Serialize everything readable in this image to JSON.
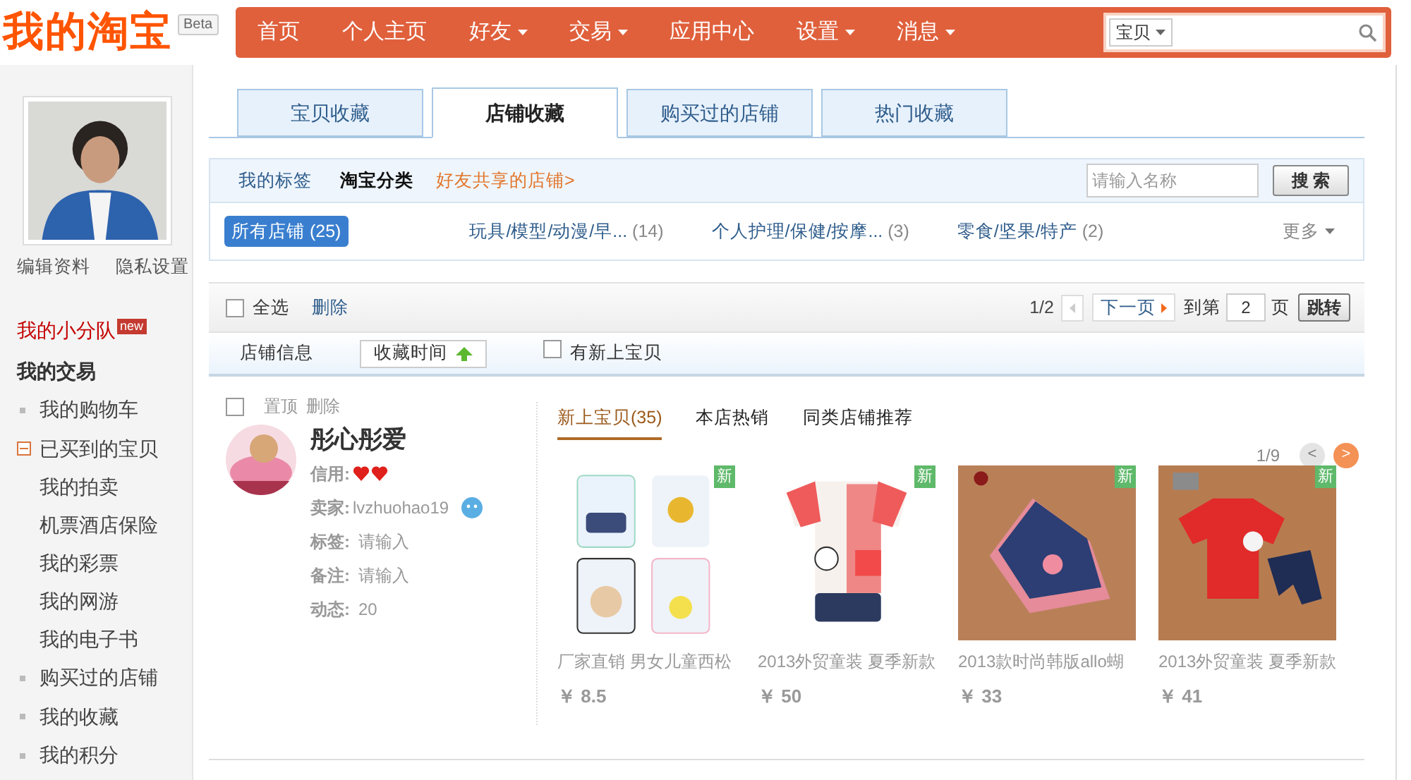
{
  "header": {
    "logo": "我的淘宝",
    "beta": "Beta",
    "nav": [
      {
        "label": "首页",
        "dropdown": false
      },
      {
        "label": "个人主页",
        "dropdown": false
      },
      {
        "label": "好友",
        "dropdown": true
      },
      {
        "label": "交易",
        "dropdown": true
      },
      {
        "label": "应用中心",
        "dropdown": false
      },
      {
        "label": "设置",
        "dropdown": true
      },
      {
        "label": "消息",
        "dropdown": true
      }
    ],
    "search": {
      "scope": "宝贝"
    }
  },
  "sidebar": {
    "profile_links": [
      "编辑资料",
      "隐私设置"
    ],
    "items": [
      {
        "kind": "feature",
        "label": "我的小分队",
        "badge": "new"
      },
      {
        "kind": "heading",
        "label": "我的交易"
      },
      {
        "kind": "bullet",
        "label": "我的购物车"
      },
      {
        "kind": "expanded",
        "label": "已买到的宝贝"
      },
      {
        "kind": "sub",
        "label": "我的拍卖"
      },
      {
        "kind": "sub",
        "label": "机票酒店保险"
      },
      {
        "kind": "sub",
        "label": "我的彩票"
      },
      {
        "kind": "sub",
        "label": "我的网游"
      },
      {
        "kind": "sub",
        "label": "我的电子书"
      },
      {
        "kind": "bullet",
        "label": "购买过的店铺"
      },
      {
        "kind": "bullet",
        "label": "我的收藏"
      },
      {
        "kind": "bullet",
        "label": "我的积分"
      }
    ]
  },
  "tabs": [
    {
      "label": "宝贝收藏",
      "selected": false
    },
    {
      "label": "店铺收藏",
      "selected": true
    },
    {
      "label": "购买过的店铺",
      "selected": false
    },
    {
      "label": "热门收藏",
      "selected": false
    }
  ],
  "filter": {
    "subtabs": [
      {
        "label": "我的标签",
        "selected": false
      },
      {
        "label": "淘宝分类",
        "selected": true
      }
    ],
    "shared_link": "好友共享的店铺>",
    "search_placeholder": "请输入名称",
    "search_button": "搜 索",
    "categories": [
      {
        "label": "所有店铺",
        "count": "(25)",
        "selected": true
      },
      {
        "label": "玩具/模型/动漫/早...",
        "count": "(14)",
        "selected": false
      },
      {
        "label": "个人护理/保健/按摩...",
        "count": "(3)",
        "selected": false
      },
      {
        "label": "零食/坚果/特产",
        "count": "(2)",
        "selected": false
      }
    ],
    "more": "更多"
  },
  "toolbar": {
    "select_all": {
      "label": "全选",
      "checked": false
    },
    "delete": "删除",
    "page": "1/2",
    "next": "下一页",
    "goto_label": "到第",
    "goto_value": "2",
    "page_unit": "页",
    "jump": "跳转"
  },
  "sortbar": {
    "info": "店铺信息",
    "sort": "收藏时间",
    "new_only": {
      "label": "有新上宝贝",
      "checked": false
    }
  },
  "shop": {
    "checked": false,
    "pin": "置顶",
    "delete": "删除",
    "name": "彤心彤爱",
    "fields": [
      {
        "kind": "hearts",
        "label": "信用:"
      },
      {
        "kind": "seller",
        "label": "卖家:",
        "value": "lvzhuohao19"
      },
      {
        "kind": "text",
        "label": "标签:",
        "value": "请输入"
      },
      {
        "kind": "text",
        "label": "备注:",
        "value": "请输入"
      },
      {
        "kind": "text",
        "label": "动态:",
        "value": "20"
      }
    ],
    "tabs": [
      {
        "label": "新上宝贝(35)",
        "selected": true
      },
      {
        "label": "本店热销",
        "selected": false
      },
      {
        "label": "同类店铺推荐",
        "selected": false
      }
    ],
    "pager": "1/9",
    "prev": "<",
    "next": ">",
    "products": [
      {
        "kind": "tanks",
        "badge": "新",
        "title": "厂家直销 男女儿童西松",
        "price": "￥ 8.5"
      },
      {
        "kind": "shirt",
        "badge": "新",
        "title": "2013外贸童装 夏季新款",
        "price": "￥ 50"
      },
      {
        "kind": "skirt",
        "badge": "新",
        "title": "2013款时尚韩版allo蝴",
        "price": "￥ 33"
      },
      {
        "kind": "tee",
        "badge": "新",
        "title": "2013外贸童装 夏季新款",
        "price": "￥ 41"
      }
    ]
  }
}
